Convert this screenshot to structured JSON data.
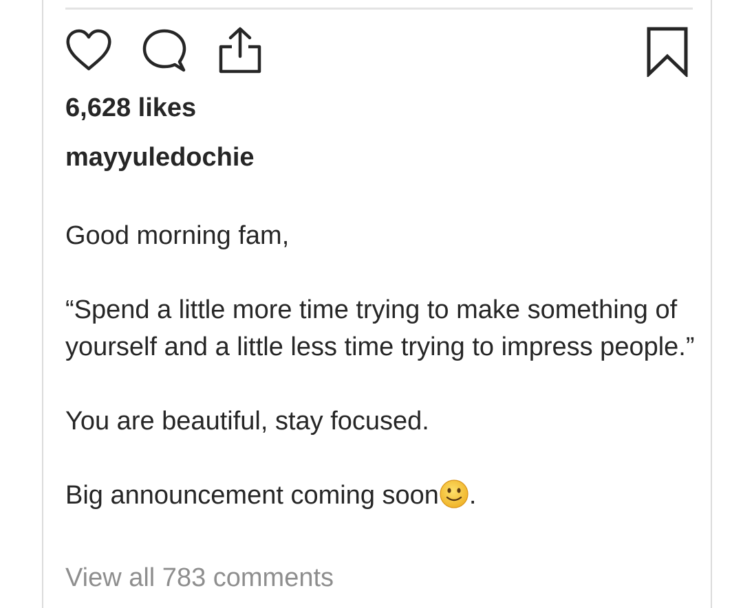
{
  "post": {
    "likes_text": "6,628 likes",
    "username": "mayyuledochie",
    "caption": {
      "line1": "Good morning fam,",
      "quote": "“Spend a little more time trying to make something of yourself and a little less time trying to impress people.”",
      "line3": "You are beautiful, stay focused.",
      "line4_text": "Big announcement coming soon",
      "line4_emoji": "slightly-smiling-face-emoji",
      "line4_suffix": "."
    },
    "view_comments_text": "View all 783 comments"
  },
  "icons": {
    "like": "heart-icon",
    "comment": "comment-bubble-icon",
    "share": "share-icon",
    "save": "bookmark-icon"
  },
  "colors": {
    "text": "#262626",
    "muted": "#8e8e8e",
    "divider": "#dbdbdb",
    "emoji_face": "#f7c531"
  }
}
